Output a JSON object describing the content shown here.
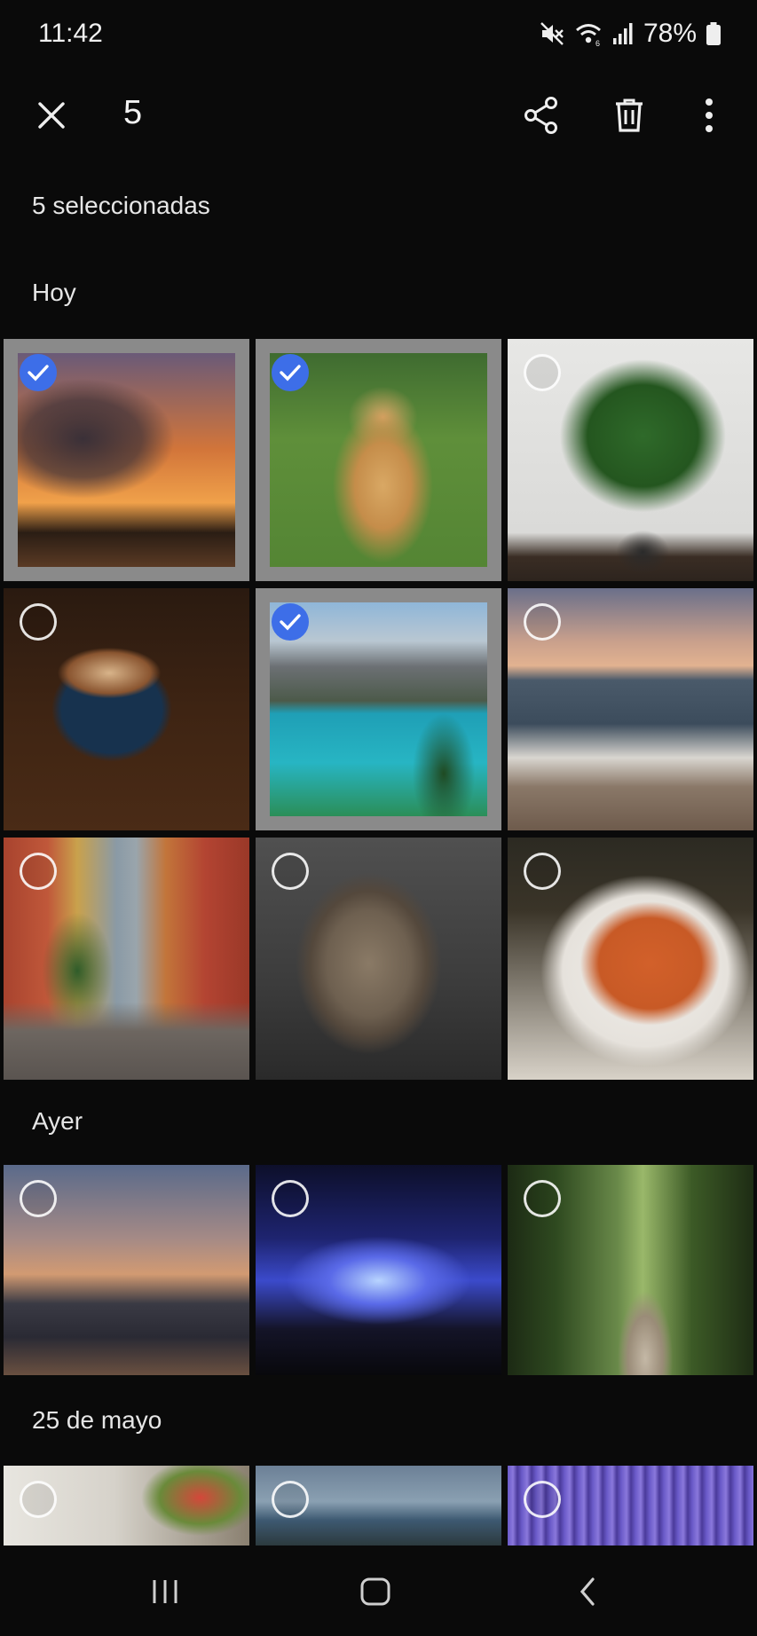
{
  "status_bar": {
    "time": "11:42",
    "battery": "78%",
    "icons": [
      "mute-icon",
      "wifi-icon",
      "signal-icon",
      "battery-icon"
    ]
  },
  "top_bar": {
    "count": "5",
    "icons": [
      "close-icon",
      "share-icon",
      "delete-icon",
      "more-icon"
    ]
  },
  "selection": {
    "label": "5 seleccionadas"
  },
  "sections": [
    {
      "title": "Hoy",
      "photos": [
        {
          "subject": "sunset",
          "selected": true
        },
        {
          "subject": "dog",
          "selected": true
        },
        {
          "subject": "plant",
          "selected": false
        },
        {
          "subject": "coffee",
          "selected": false
        },
        {
          "subject": "mountain-lake",
          "selected": true
        },
        {
          "subject": "beach",
          "selected": false
        },
        {
          "subject": "street",
          "selected": false
        },
        {
          "subject": "cat",
          "selected": false
        },
        {
          "subject": "pasta",
          "selected": false
        }
      ]
    },
    {
      "title": "Ayer",
      "photos": [
        {
          "subject": "city-skyline",
          "selected": false
        },
        {
          "subject": "concert",
          "selected": false
        },
        {
          "subject": "forest-path",
          "selected": false
        }
      ]
    },
    {
      "title": "25 de mayo",
      "photos": [
        {
          "subject": "flowers-balcony",
          "selected": false
        },
        {
          "subject": "coast",
          "selected": false
        },
        {
          "subject": "lavender",
          "selected": false
        }
      ]
    }
  ],
  "nav_bar": {
    "icons": [
      "recents-icon",
      "home-icon",
      "back-icon"
    ]
  },
  "colors": {
    "accent": "#3d6ee8",
    "background": "#0a0a0a",
    "selected_frame": "#8a8a8a"
  }
}
